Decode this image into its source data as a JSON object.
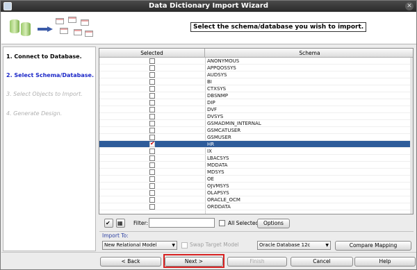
{
  "window": {
    "title": "Data Dictionary Import Wizard",
    "close_glyph": "✕"
  },
  "header": {
    "instruction": "Select the schema/database you wish to import."
  },
  "steps": [
    {
      "label": "1. Connect to Database.",
      "state": "done"
    },
    {
      "label": "2. Select Schema/Database.",
      "state": "current"
    },
    {
      "label": "3. Select Objects to Import.",
      "state": "disabled"
    },
    {
      "label": "4. Generate Design.",
      "state": "disabled"
    }
  ],
  "grid": {
    "columns": [
      "Selected",
      "Schema"
    ],
    "rows": [
      {
        "name": "ANONYMOUS",
        "checked": false
      },
      {
        "name": "APPQOSSYS",
        "checked": false
      },
      {
        "name": "AUDSYS",
        "checked": false
      },
      {
        "name": "BI",
        "checked": false
      },
      {
        "name": "CTXSYS",
        "checked": false
      },
      {
        "name": "DBSNMP",
        "checked": false
      },
      {
        "name": "DIP",
        "checked": false
      },
      {
        "name": "DVF",
        "checked": false
      },
      {
        "name": "DVSYS",
        "checked": false
      },
      {
        "name": "GSMADMIN_INTERNAL",
        "checked": false
      },
      {
        "name": "GSMCATUSER",
        "checked": false
      },
      {
        "name": "GSMUSER",
        "checked": false
      },
      {
        "name": "HR",
        "checked": true,
        "selected": true
      },
      {
        "name": "IX",
        "checked": false
      },
      {
        "name": "LBACSYS",
        "checked": false
      },
      {
        "name": "MDDATA",
        "checked": false
      },
      {
        "name": "MDSYS",
        "checked": false
      },
      {
        "name": "OE",
        "checked": false
      },
      {
        "name": "OJVMSYS",
        "checked": false
      },
      {
        "name": "OLAPSYS",
        "checked": false
      },
      {
        "name": "ORACLE_OCM",
        "checked": false
      },
      {
        "name": "ORDDATA",
        "checked": false
      }
    ]
  },
  "filter": {
    "label": "Filter:",
    "value": "",
    "all_selected_label": "All Selected",
    "options_label": "Options"
  },
  "import_to": {
    "label": "Import To:",
    "model": "New Relational Model",
    "swap_label": "Swap Target Model",
    "database": "Oracle Database 12c",
    "compare_label": "Compare Mapping"
  },
  "buttons": {
    "back": "< Back",
    "next": "Next >",
    "finish": "Finish",
    "cancel": "Cancel",
    "help": "Help"
  },
  "colors": {
    "title_bar": "#2a2a2a",
    "current_step": "#1c28c8",
    "selected_row": "#2e5c9a",
    "highlight": "#d82020"
  }
}
